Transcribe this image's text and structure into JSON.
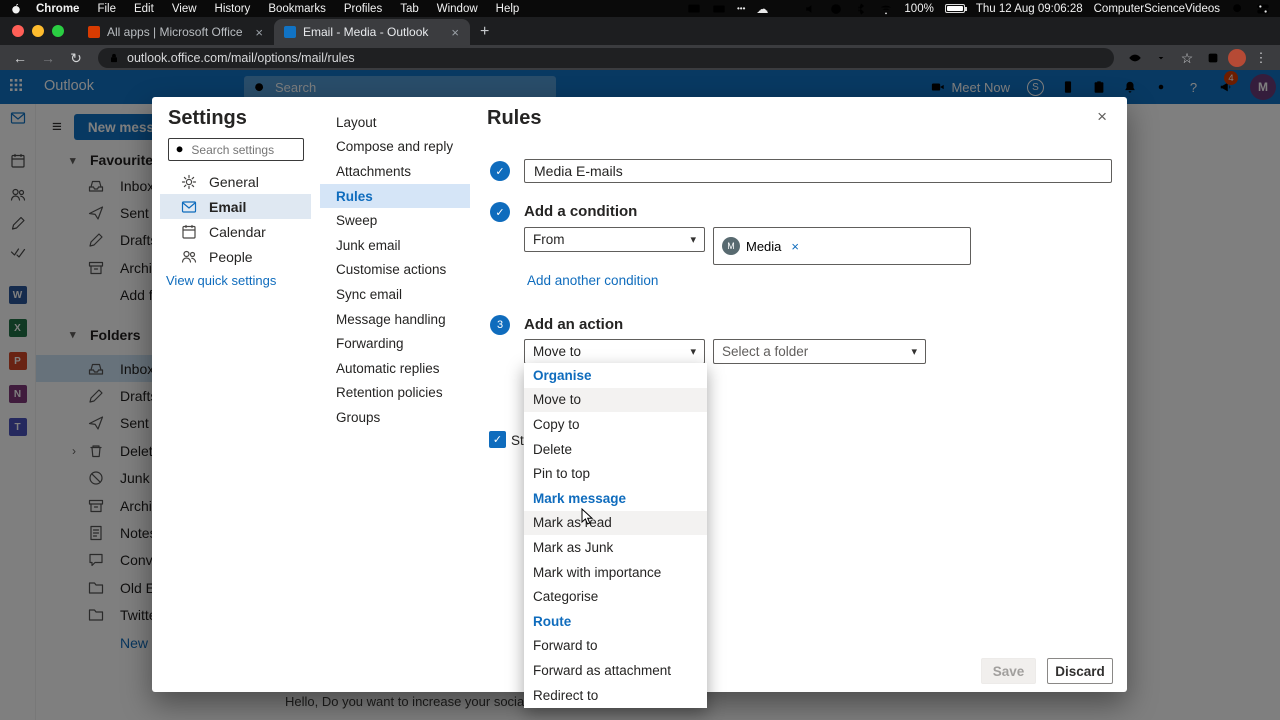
{
  "glyphs": {
    "close": "×",
    "plus": "+",
    "back": "←",
    "forward": "→",
    "reload": "↻",
    "star": "☆",
    "dots_v": "⋮",
    "dots_h": "•••",
    "cloud": "☁",
    "hamburger": "≡",
    "chevron_down": "▾",
    "chevron_right": "›",
    "check": "✓",
    "question": "?",
    "skype": "S"
  },
  "menubar": {
    "items": [
      "Chrome",
      "File",
      "Edit",
      "View",
      "History",
      "Bookmarks",
      "Profiles",
      "Tab",
      "Window",
      "Help"
    ],
    "battery_pct": "100%",
    "datetime": "Thu 12 Aug 09:06:28",
    "account": "ComputerScienceVideos"
  },
  "browser": {
    "tabs": [
      {
        "title": "All apps | Microsoft Office"
      },
      {
        "title": "Email - Media - Outlook"
      }
    ],
    "url": "outlook.office.com/mail/options/mail/rules"
  },
  "outlook": {
    "app_name": "Outlook",
    "search_placeholder": "Search",
    "meet_now_label": "Meet Now",
    "notification_badge": "4",
    "header_avatar": "M",
    "new_message_label": "New message",
    "favourites_header": "Favourites",
    "favourites": [
      {
        "label": "Inbox"
      },
      {
        "label": "Sent Items"
      },
      {
        "label": "Drafts"
      },
      {
        "label": "Archive"
      },
      {
        "label": "Add favourite"
      }
    ],
    "folders_header": "Folders",
    "folders": [
      {
        "label": "Inbox"
      },
      {
        "label": "Drafts"
      },
      {
        "label": "Sent Items"
      },
      {
        "label": "Deleted Items"
      },
      {
        "label": "Junk Email"
      },
      {
        "label": "Archive"
      },
      {
        "label": "Notes"
      },
      {
        "label": "Conversation H"
      },
      {
        "label": "Old Emails"
      },
      {
        "label": "Twitter"
      },
      {
        "label": "New folder"
      }
    ],
    "office_apps": [
      "W",
      "X",
      "P",
      "N",
      "T"
    ],
    "preview_text": "Hello, Do you want to increase your social media"
  },
  "settings": {
    "title": "Settings",
    "search_placeholder": "Search settings",
    "categories": [
      {
        "label": "General"
      },
      {
        "label": "Email"
      },
      {
        "label": "Calendar"
      },
      {
        "label": "People"
      }
    ],
    "quick_settings_link": "View quick settings",
    "sections": [
      "Layout",
      "Compose and reply",
      "Attachments",
      "Rules",
      "Sweep",
      "Junk email",
      "Customise actions",
      "Sync email",
      "Message handling",
      "Forwarding",
      "Automatic replies",
      "Retention policies",
      "Groups"
    ]
  },
  "rules_panel": {
    "title": "Rules",
    "rule_name": "Media E-mails",
    "condition_heading": "Add a condition",
    "condition_selected": "From",
    "condition_chip": {
      "initial": "M",
      "label": "Media"
    },
    "add_condition_link": "Add another condition",
    "step_number": "3",
    "action_heading": "Add an action",
    "action_selected": "Move to",
    "folder_placeholder": "Select a folder",
    "stop_processing_label": "Sto",
    "save_label": "Save",
    "discard_label": "Discard"
  },
  "action_menu": {
    "groups": [
      {
        "header": "Organise",
        "items": [
          "Move to",
          "Copy to",
          "Delete",
          "Pin to top"
        ]
      },
      {
        "header": "Mark message",
        "items": [
          "Mark as read",
          "Mark as Junk",
          "Mark with importance",
          "Categorise"
        ]
      },
      {
        "header": "Route",
        "items": [
          "Forward to",
          "Forward as attachment",
          "Redirect to"
        ]
      }
    ]
  }
}
